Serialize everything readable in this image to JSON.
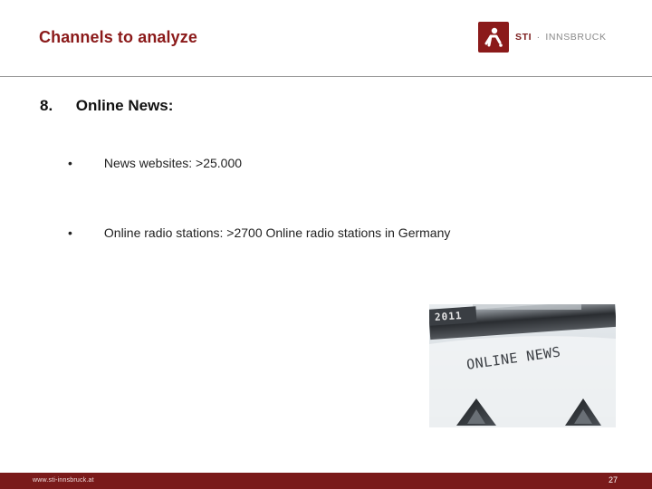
{
  "slide": {
    "title": "Channels to analyze",
    "section_number": "8.",
    "section_heading": "Online News:",
    "bullets": [
      "News websites: >25.000",
      "Online radio stations: >2700 Online radio stations in Germany"
    ],
    "bullet_symbol": "•"
  },
  "logo": {
    "brand": "STI",
    "separator": "·",
    "city": "INNSBRUCK",
    "color": "#8b1a1a",
    "icon": "sti-figure-icon"
  },
  "photo": {
    "key_label": "2011",
    "typed_text": "ONLINE NEWS"
  },
  "footer": {
    "url": "www.sti-innsbruck.at",
    "page_number": "27",
    "color": "#7a1a1a"
  }
}
